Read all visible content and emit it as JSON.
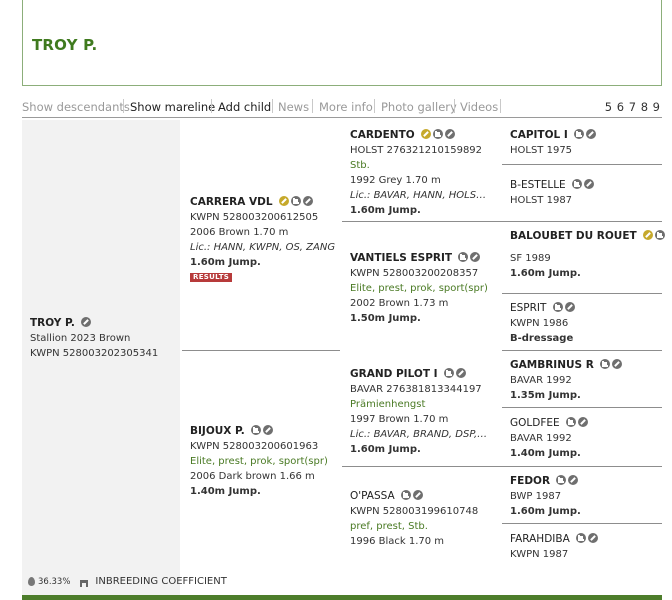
{
  "page": {
    "title": "TROY P."
  },
  "nav": {
    "items": [
      "Show descendants",
      "Show mareline",
      "Add child",
      "News",
      "More info",
      "Photo gallery",
      "Videos"
    ],
    "generations": "5 6 7 8 9"
  },
  "subject": {
    "name": "TROY P.",
    "line1": "Stallion 2023 Brown",
    "line2": "KWPN 528003202305341"
  },
  "sire": {
    "name": "CARRERA VDL",
    "reg": "KWPN 528003200612505",
    "details": "2006 Brown 1.70 m",
    "lic": "Lic.: HANN, KWPN, OS, ZANG",
    "sport": "1.60m Jump.",
    "badge": "RESULTS"
  },
  "dam": {
    "name": "BIJOUX P.",
    "reg": "KWPN 528003200601963",
    "predicates": "Elite, prest, prok, sport(spr)",
    "details": "2006 Dark brown 1.66 m",
    "sport": "1.40m Jump."
  },
  "ss": {
    "name": "CARDENTO",
    "reg": "HOLST 276321210159892",
    "predicates": "Stb.",
    "details": "1992 Grey 1.70 m",
    "lic": "Lic.: BAVAR, HANN, HOLST, ISH, ...",
    "sport": "1.60m Jump."
  },
  "sd": {
    "name": "VANTIELS ESPRIT",
    "reg": "KWPN 528003200208357",
    "predicates": "Elite, prest, prok, sport(spr)",
    "details": "2002 Brown 1.73 m",
    "sport": "1.50m Jump."
  },
  "ds": {
    "name": "GRAND PILOT I",
    "reg": "BAVAR 276381813344197",
    "predicates": "Prämienhengst",
    "details": "1997 Brown 1.70 m",
    "lic": "Lic.: BAVAR, BRAND, DSP, Mo, O...",
    "sport": "1.60m Jump."
  },
  "dd": {
    "name": "O'PASSA",
    "reg": "KWPN 528003199610748",
    "predicates": "pref, prest, Stb.",
    "details": "1996 Black 1.70 m"
  },
  "sss": {
    "name": "CAPITOL I",
    "reg": "HOLST 1975"
  },
  "ssd": {
    "name": "B-ESTELLE",
    "reg": "HOLST 1987"
  },
  "sds": {
    "name": "BALOUBET DU ROUET",
    "reg": "SF 1989",
    "sport": "1.60m Jump."
  },
  "sdd": {
    "name": "ESPRIT",
    "reg": "KWPN 1986",
    "sport": "B-dressage"
  },
  "dss": {
    "name": "GAMBRINUS R",
    "reg": "BAVAR 1992",
    "sport": "1.35m Jump."
  },
  "dsd": {
    "name": "GOLDFEE",
    "reg": "BAVAR 1992",
    "sport": "1.40m Jump."
  },
  "dds": {
    "name": "FEDOR",
    "reg": "BWP 1987",
    "sport": "1.60m Jump."
  },
  "ddd": {
    "name": "FARAHDIBA",
    "reg": "KWPN 1987"
  },
  "footer": {
    "percent": "36.33%",
    "label": "INBREEDING COEFFICIENT"
  }
}
